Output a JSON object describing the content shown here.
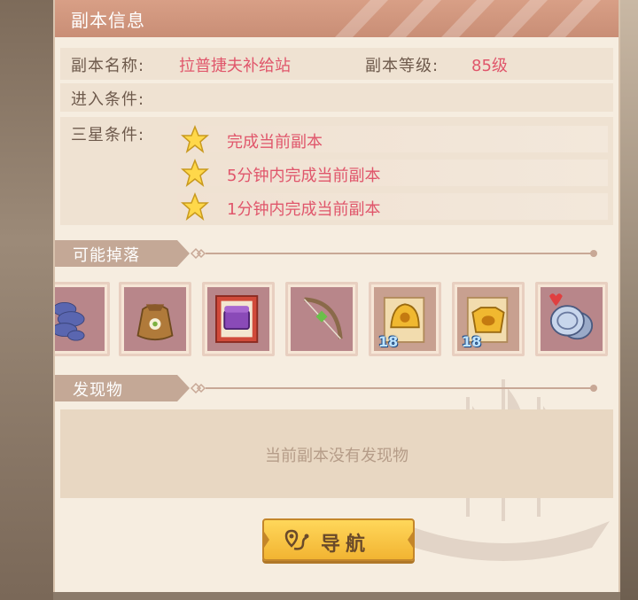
{
  "header": {
    "title": "副本信息"
  },
  "info": {
    "name_label": "副本名称:",
    "name_value": "拉普捷夫补给站",
    "level_label": "副本等级:",
    "level_value": "85级",
    "entry_label": "进入条件:",
    "star_label": "三星条件:"
  },
  "star_conditions": [
    {
      "text": "完成当前副本"
    },
    {
      "text": "5分钟内完成当前副本"
    },
    {
      "text": "1分钟内完成当前副本"
    }
  ],
  "drops_section": {
    "title": "可能掉落"
  },
  "drops": [
    {
      "icon": "blue-feather-icon"
    },
    {
      "icon": "seed-bag-icon"
    },
    {
      "icon": "purple-chest-card-icon"
    },
    {
      "icon": "green-bow-icon"
    },
    {
      "icon": "gold-helmet-icon",
      "badge": "18"
    },
    {
      "icon": "gold-armor-icon",
      "badge": "18"
    },
    {
      "icon": "silver-coin-heart-icon"
    }
  ],
  "discover_section": {
    "title": "发现物"
  },
  "discover": {
    "empty_text": "当前副本没有发现物"
  },
  "nav_button": {
    "label": "导航"
  },
  "colors": {
    "header": "#d4987f",
    "accent_red": "#e0566b",
    "button_gold": "#f5c042"
  }
}
